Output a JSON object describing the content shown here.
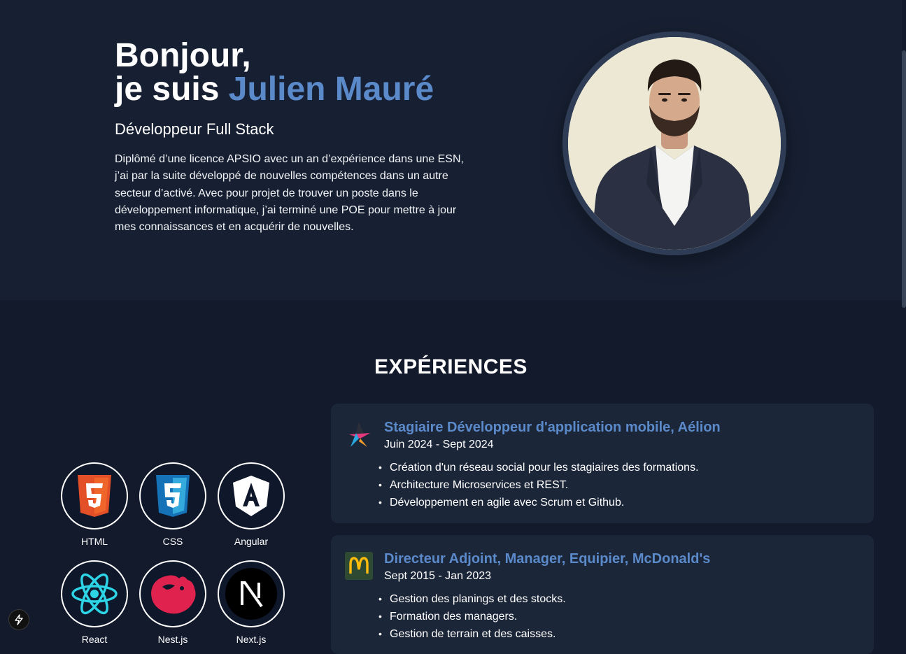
{
  "hero": {
    "greeting": "Bonjour,",
    "intro_prefix": "je suis ",
    "name": "Julien Mauré",
    "role": "Développeur Full Stack",
    "description": "Diplômé d’une licence APSIO avec un an d’expérience dans une ESN, j’ai par la suite développé de nouvelles compétences dans un autre secteur d’activé. Avec pour projet de trouver un poste dans le développement informatique, j’ai terminé une POE pour mettre à jour mes connaissances et en acquérir de nouvelles."
  },
  "experiences": {
    "title": "EXPÉRIENCES",
    "items": [
      {
        "title": "Stagiaire Développeur d'application mobile, Aélion",
        "dates": "Juin 2024 - Sept 2024",
        "logo_icon": "aelion-star-logo",
        "bullets": [
          "Création d'un réseau social pour les stagiaires des formations.",
          "Architecture Microservices et REST.",
          "Développement en agile avec Scrum et Github."
        ]
      },
      {
        "title": "Directeur Adjoint, Manager, Equipier, McDonald's",
        "dates": "Sept 2015 - Jan 2023",
        "logo_icon": "mcdonalds-logo",
        "bullets": [
          "Gestion des planings et des stocks.",
          "Formation des managers.",
          "Gestion de terrain et des caisses."
        ]
      }
    ]
  },
  "skills": [
    {
      "label": "HTML",
      "icon": "html5-icon"
    },
    {
      "label": "CSS",
      "icon": "css3-icon"
    },
    {
      "label": "Angular",
      "icon": "angular-icon"
    },
    {
      "label": "React",
      "icon": "react-icon"
    },
    {
      "label": "Nest.js",
      "icon": "nestjs-icon"
    },
    {
      "label": "Next.js",
      "icon": "nextjs-icon"
    }
  ],
  "colors": {
    "accent": "#5b8acb",
    "hero_bg": "#172032",
    "page_bg": "#121a2c",
    "card_bg": "#1c2639"
  }
}
